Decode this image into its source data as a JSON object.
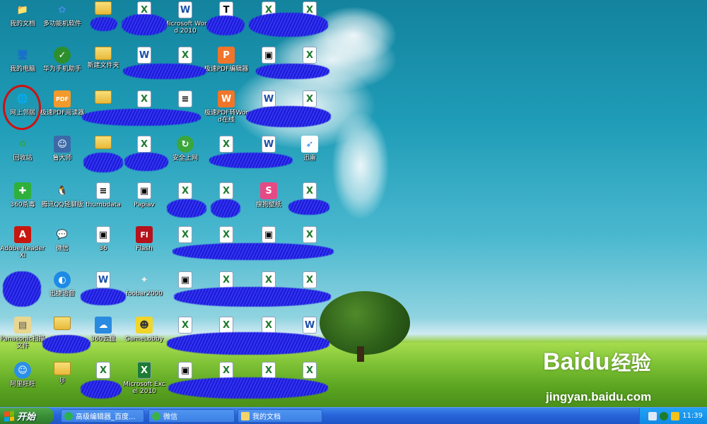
{
  "desktop": {
    "icons": [
      {
        "label": "我的文档",
        "icon": "my-documents-icon",
        "glyph": "📁"
      },
      {
        "label": "多功能机软件",
        "icon": "multifunction-software-icon",
        "glyph": "✿"
      },
      {
        "label": "",
        "icon": "folder-icon",
        "glyph": ""
      },
      {
        "label": "",
        "icon": "excel-file-icon",
        "glyph": "X"
      },
      {
        "label": "Microsoft Word 2010",
        "icon": "word-file-icon",
        "glyph": "W"
      },
      {
        "label": "",
        "icon": "tiff-file-icon",
        "glyph": "T"
      },
      {
        "label": "",
        "icon": "excel-file-icon",
        "glyph": "X"
      },
      {
        "label": "",
        "icon": "excel-file-icon",
        "glyph": "X"
      },
      {
        "label": "我的电脑",
        "icon": "my-computer-icon",
        "glyph": "🖥"
      },
      {
        "label": "华为手机助手",
        "icon": "huawei-assistant-icon",
        "glyph": "✓"
      },
      {
        "label": "新建文件夹",
        "icon": "folder-icon",
        "glyph": ""
      },
      {
        "label": "",
        "icon": "word-file-icon",
        "glyph": "W"
      },
      {
        "label": "",
        "icon": "excel-file-icon",
        "glyph": "X"
      },
      {
        "label": "极速PDF编辑器",
        "icon": "pdf-editor-icon",
        "glyph": "P"
      },
      {
        "label": "",
        "icon": "image-file-icon",
        "glyph": "▣"
      },
      {
        "label": "",
        "icon": "excel-file-icon",
        "glyph": "X"
      },
      {
        "label": "网上邻居",
        "icon": "network-neighborhood-icon",
        "glyph": "🌐"
      },
      {
        "label": "极速PDF阅读器",
        "icon": "pdf-reader-icon",
        "glyph": "PDF"
      },
      {
        "label": "",
        "icon": "folder-icon",
        "glyph": ""
      },
      {
        "label": "",
        "icon": "excel-file-icon",
        "glyph": "X"
      },
      {
        "label": "",
        "icon": "text-file-icon",
        "glyph": "≡"
      },
      {
        "label": "极速PDF转Word在线",
        "icon": "pdf-to-word-icon",
        "glyph": "W"
      },
      {
        "label": "",
        "icon": "word-file-icon",
        "glyph": "W"
      },
      {
        "label": "",
        "icon": "excel-file-icon",
        "glyph": "X"
      },
      {
        "label": "回收站",
        "icon": "recycle-bin-icon",
        "glyph": "♻"
      },
      {
        "label": "鲁大师",
        "icon": "ludashi-icon",
        "glyph": "☺"
      },
      {
        "label": "",
        "icon": "folder-icon",
        "glyph": ""
      },
      {
        "label": "",
        "icon": "excel-file-icon",
        "glyph": "X"
      },
      {
        "label": "安全上网",
        "icon": "secure-browsing-icon",
        "glyph": "↻"
      },
      {
        "label": "",
        "icon": "excel-file-icon",
        "glyph": "X"
      },
      {
        "label": "",
        "icon": "word-file-icon",
        "glyph": "W"
      },
      {
        "label": "迅雷",
        "icon": "xunlei-icon",
        "glyph": "➶"
      },
      {
        "label": "360杀毒",
        "icon": "antivirus-360-icon",
        "glyph": "✚"
      },
      {
        "label": "腾讯QQ轻聊版",
        "icon": "qq-icon",
        "glyph": "🐧"
      },
      {
        "label": "thumbdata",
        "icon": "data-file-icon",
        "glyph": "≡"
      },
      {
        "label": "Papiav",
        "icon": "image-file-icon",
        "glyph": "▣"
      },
      {
        "label": "",
        "icon": "excel-file-icon",
        "glyph": "X"
      },
      {
        "label": "",
        "icon": "excel-file-icon",
        "glyph": "X"
      },
      {
        "label": "搜狗壁纸",
        "icon": "sogou-wallpaper-icon",
        "glyph": "S"
      },
      {
        "label": "",
        "icon": "excel-file-icon",
        "glyph": "X"
      },
      {
        "label": "Adobe Reader XI",
        "icon": "adobe-reader-icon",
        "glyph": "A"
      },
      {
        "label": "微信",
        "icon": "wechat-icon",
        "glyph": "💬"
      },
      {
        "label": "36",
        "icon": "image-file-icon",
        "glyph": "▣"
      },
      {
        "label": "Flash",
        "icon": "flash-icon",
        "glyph": "Fl"
      },
      {
        "label": "",
        "icon": "excel-file-icon",
        "glyph": "X"
      },
      {
        "label": "",
        "icon": "excel-file-icon",
        "glyph": "X"
      },
      {
        "label": "",
        "icon": "image-file-icon",
        "glyph": "▣"
      },
      {
        "label": "",
        "icon": "excel-file-icon",
        "glyph": "X"
      },
      {
        "label": "",
        "icon": "hidden-icon",
        "glyph": ""
      },
      {
        "label": "迅捷语音",
        "icon": "xunjie-voice-icon",
        "glyph": "◐"
      },
      {
        "label": "",
        "icon": "word-file-icon",
        "glyph": "W"
      },
      {
        "label": "foobar2000",
        "icon": "foobar-icon",
        "glyph": "✦"
      },
      {
        "label": "",
        "icon": "image-file-icon",
        "glyph": "▣"
      },
      {
        "label": "",
        "icon": "excel-file-icon",
        "glyph": "X"
      },
      {
        "label": "",
        "icon": "excel-file-icon",
        "glyph": "X"
      },
      {
        "label": "",
        "icon": "excel-file-icon",
        "glyph": "X"
      },
      {
        "label": "Panasonic扫描文件",
        "icon": "panasonic-scan-icon",
        "glyph": "▤"
      },
      {
        "label": "",
        "icon": "folder-icon",
        "glyph": ""
      },
      {
        "label": "360云盘",
        "icon": "cloud-drive-icon",
        "glyph": "☁"
      },
      {
        "label": "GameLobby",
        "icon": "game-lobby-icon",
        "glyph": "☻"
      },
      {
        "label": "",
        "icon": "excel-file-icon",
        "glyph": "X"
      },
      {
        "label": "",
        "icon": "excel-file-icon",
        "glyph": "X"
      },
      {
        "label": "",
        "icon": "excel-file-icon",
        "glyph": "X"
      },
      {
        "label": "",
        "icon": "word-file-icon",
        "glyph": "W"
      },
      {
        "label": "阿里旺旺",
        "icon": "aliwangwang-icon",
        "glyph": "☺"
      },
      {
        "label": "ljl",
        "icon": "folder-icon",
        "glyph": ""
      },
      {
        "label": "",
        "icon": "excel-file-icon",
        "glyph": "X"
      },
      {
        "label": "Microsoft Excel 2010",
        "icon": "excel-app-icon",
        "glyph": "X"
      },
      {
        "label": "",
        "icon": "image-file-icon",
        "glyph": "▣"
      },
      {
        "label": "",
        "icon": "excel-file-icon",
        "glyph": "X"
      },
      {
        "label": "",
        "icon": "excel-file-icon",
        "glyph": "X"
      },
      {
        "label": "",
        "icon": "excel-file-icon",
        "glyph": "X"
      }
    ]
  },
  "watermark": {
    "brand_latin": "Bai",
    "brand_paw": "du",
    "brand_cn": "经验",
    "url": "jingyan.baidu.com"
  },
  "taskbar": {
    "start_label": "开始",
    "buttons": [
      {
        "label": "高级编辑器_百度...",
        "icon": "browser-icon"
      },
      {
        "label": "微信",
        "icon": "wechat-icon"
      },
      {
        "label": "我的文档",
        "icon": "folder-icon"
      }
    ],
    "clock": "11:39"
  },
  "colors": {
    "taskbar_blue": "#2764d9",
    "start_green": "#3a8f37",
    "scribble_blue": "#1f1fd8",
    "highlight_red": "#d01010"
  }
}
